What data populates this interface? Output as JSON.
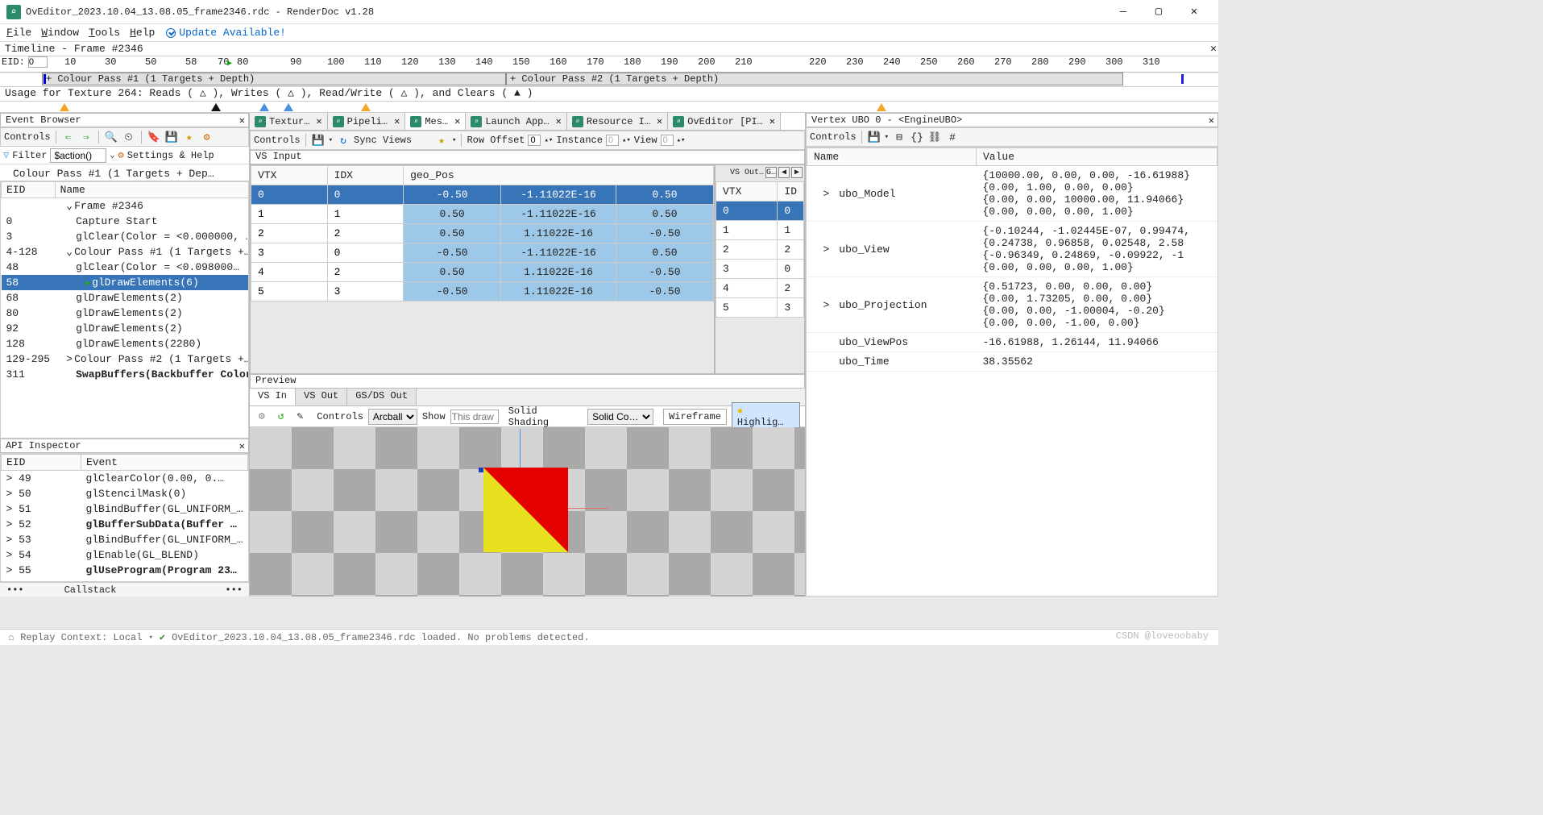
{
  "window": {
    "title": "OvEditor_2023.10.04_13.08.05_frame2346.rdc - RenderDoc v1.28"
  },
  "menu": {
    "file": "File",
    "window": "Window",
    "tools": "Tools",
    "help": "Help",
    "update": "Update Available!"
  },
  "timeline": {
    "title": "Timeline - Frame #2346",
    "eid_label": "EID:",
    "eid_value": "0",
    "ticks": [
      "10",
      "30",
      "50",
      "58",
      "70",
      "80",
      "90",
      "100",
      "110",
      "120",
      "130",
      "140",
      "150",
      "160",
      "170",
      "180",
      "190",
      "200",
      "210",
      "220",
      "230",
      "240",
      "250",
      "260",
      "270",
      "280",
      "290",
      "300",
      "310"
    ],
    "pass1": "+ Colour Pass #1 (1 Targets + Depth)",
    "pass2": "+ Colour Pass #2 (1 Targets + Depth)",
    "usage": "Usage for Texture 264: Reads ( △ ), Writes ( △ ), Read/Write ( △ ), and Clears ( ▲ )"
  },
  "event_browser": {
    "title": "Event Browser",
    "controls": "Controls",
    "filter_label": "Filter",
    "filter_value": "$action()",
    "settings": "Settings & Help",
    "breadcrumb": "Colour Pass #1 (1 Targets + Dep…",
    "cols": {
      "eid": "EID",
      "name": "Name"
    },
    "rows": [
      {
        "eid": "",
        "name": "Frame #2346",
        "ind": 1,
        "exp": "⌄"
      },
      {
        "eid": "0",
        "name": "Capture Start",
        "ind": 2
      },
      {
        "eid": "3",
        "name": "glClear(Color = <0.000000, …",
        "ind": 2
      },
      {
        "eid": "4-128",
        "name": "Colour Pass #1 (1 Targets +…",
        "ind": 1,
        "exp": "⌄"
      },
      {
        "eid": "48",
        "name": "glClear(Color = <0.098000…",
        "ind": 2
      },
      {
        "eid": "58",
        "name": "glDrawElements(6)",
        "ind": 3,
        "sel": true,
        "flag": true
      },
      {
        "eid": "68",
        "name": "glDrawElements(2)",
        "ind": 2
      },
      {
        "eid": "80",
        "name": "glDrawElements(2)",
        "ind": 2
      },
      {
        "eid": "92",
        "name": "glDrawElements(2)",
        "ind": 2
      },
      {
        "eid": "128",
        "name": "glDrawElements(2280)",
        "ind": 2
      },
      {
        "eid": "129-295",
        "name": "Colour Pass #2 (1 Targets +…",
        "ind": 1,
        "exp": ">"
      },
      {
        "eid": "311",
        "name": "SwapBuffers(Backbuffer Color…",
        "ind": 2,
        "bold": true
      }
    ]
  },
  "api": {
    "title": "API Inspector",
    "cols": {
      "eid": "EID",
      "event": "Event"
    },
    "rows": [
      {
        "eid": "49",
        "event": "glClearColor(0.00, 0.…"
      },
      {
        "eid": "50",
        "event": "glStencilMask(0)"
      },
      {
        "eid": "51",
        "event": "glBindBuffer(GL_UNIFORM_…"
      },
      {
        "eid": "52",
        "event": "glBufferSubData(Buffer …",
        "bold": true
      },
      {
        "eid": "53",
        "event": "glBindBuffer(GL_UNIFORM_…"
      },
      {
        "eid": "54",
        "event": "glEnable(GL_BLEND)"
      },
      {
        "eid": "55",
        "event": "glUseProgram(Program 23…",
        "bold": true
      }
    ],
    "callstack": "Callstack"
  },
  "tabs": [
    {
      "label": "Textur…"
    },
    {
      "label": "Pipeli…"
    },
    {
      "label": "Mes…",
      "active": true
    },
    {
      "label": "Launch App…"
    },
    {
      "label": "Resource I…"
    },
    {
      "label": "OvEditor [PI…"
    }
  ],
  "mesh_toolbar": {
    "controls": "Controls",
    "sync": "Sync Views",
    "rowoff": "Row Offset",
    "rowoff_v": "0",
    "instance": "Instance",
    "instance_v": "0",
    "view": "View",
    "view_v": "0"
  },
  "vsin": {
    "title": "VS Input",
    "cols": [
      "VTX",
      "IDX",
      "geo_Pos"
    ],
    "rows": [
      {
        "vtx": "0",
        "idx": "0",
        "p": [
          "-0.50",
          "-1.11022E-16",
          "0.50"
        ],
        "head": true
      },
      {
        "vtx": "1",
        "idx": "1",
        "p": [
          "0.50",
          "-1.11022E-16",
          "0.50"
        ]
      },
      {
        "vtx": "2",
        "idx": "2",
        "p": [
          "0.50",
          "1.11022E-16",
          "-0.50"
        ]
      },
      {
        "vtx": "3",
        "idx": "0",
        "p": [
          "-0.50",
          "-1.11022E-16",
          "0.50"
        ]
      },
      {
        "vtx": "4",
        "idx": "2",
        "p": [
          "0.50",
          "1.11022E-16",
          "-0.50"
        ]
      },
      {
        "vtx": "5",
        "idx": "3",
        "p": [
          "-0.50",
          "1.11022E-16",
          "-0.50"
        ]
      }
    ]
  },
  "vsout": {
    "title": "VS Out…",
    "gl": "G…",
    "cols": [
      "VTX",
      "ID"
    ],
    "rows": [
      {
        "vtx": "0",
        "id": "0",
        "head": true
      },
      {
        "vtx": "1",
        "id": "1"
      },
      {
        "vtx": "2",
        "id": "2"
      },
      {
        "vtx": "3",
        "id": "0"
      },
      {
        "vtx": "4",
        "id": "2"
      },
      {
        "vtx": "5",
        "id": "3"
      }
    ]
  },
  "preview": {
    "title": "Preview",
    "tabs": [
      "VS In",
      "VS Out",
      "GS/DS Out"
    ],
    "controls": "Controls",
    "arcball": "Arcball",
    "show": "Show",
    "show_ph": "This draw",
    "shading": "Solid Shading",
    "shading_v": "Solid Co…",
    "wire": "Wireframe",
    "hl": "Highlig…"
  },
  "ubo": {
    "title": "Vertex UBO 0 - <EngineUBO>",
    "controls": "Controls",
    "cols": {
      "name": "Name",
      "value": "Value"
    },
    "rows": [
      {
        "name": "ubo_Model",
        "value": "{10000.00, 0.00, 0.00, -16.61988}\n{0.00, 1.00, 0.00, 0.00}\n{0.00, 0.00, 10000.00, 11.94066}\n{0.00, 0.00, 0.00, 1.00}",
        "exp": true
      },
      {
        "name": "ubo_View",
        "value": "{-0.10244, -1.02445E-07, 0.99474,\n{0.24738, 0.96858, 0.02548, 2.58\n{-0.96349, 0.24869, -0.09922, -1\n{0.00, 0.00, 0.00, 1.00}",
        "exp": true
      },
      {
        "name": "ubo_Projection",
        "value": "{0.51723, 0.00, 0.00, 0.00}\n{0.00, 1.73205, 0.00, 0.00}\n{0.00, 0.00, -1.00004, -0.20}\n{0.00, 0.00, -1.00, 0.00}",
        "exp": true
      },
      {
        "name": "ubo_ViewPos",
        "value": "-16.61988, 1.26144, 11.94066"
      },
      {
        "name": "ubo_Time",
        "value": "38.35562"
      }
    ]
  },
  "status": {
    "ctx": "Replay Context: Local",
    "msg": "OvEditor_2023.10.04_13.08.05_frame2346.rdc loaded. No problems detected."
  },
  "watermark": "CSDN @loveoobaby"
}
